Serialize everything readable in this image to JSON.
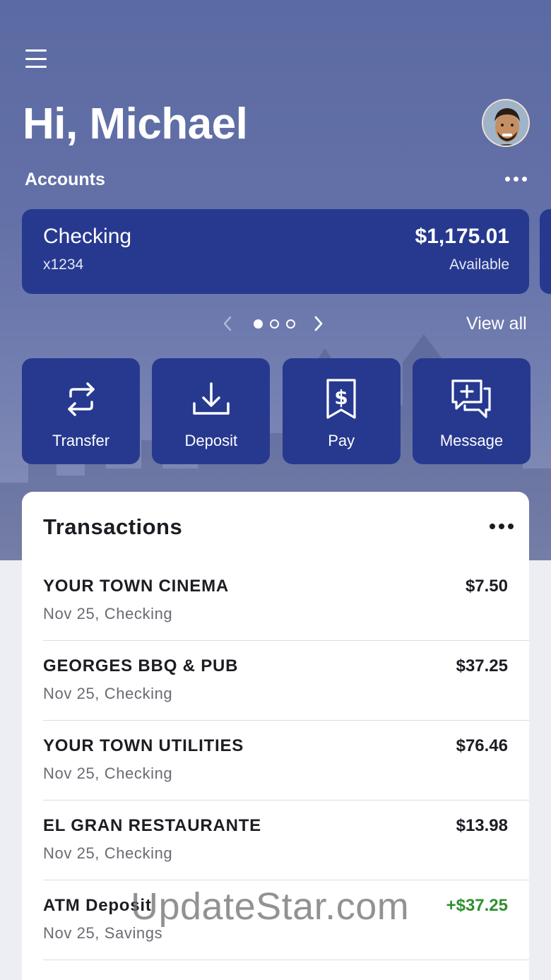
{
  "header": {
    "greeting": "Hi, Michael"
  },
  "accounts": {
    "section_label": "Accounts",
    "cards": [
      {
        "name": "Checking",
        "number": "x1234",
        "balance": "$1,175.01",
        "balance_label": "Available"
      }
    ],
    "pager": {
      "total": 3,
      "active": 1
    },
    "view_all_label": "View all"
  },
  "actions": [
    {
      "label": "Transfer",
      "icon": "transfer-icon"
    },
    {
      "label": "Deposit",
      "icon": "deposit-icon"
    },
    {
      "label": "Pay",
      "icon": "bill-pay-icon"
    },
    {
      "label": "Message",
      "icon": "message-icon"
    }
  ],
  "transactions": {
    "title": "Transactions",
    "items": [
      {
        "name": "YOUR TOWN CINEMA",
        "detail": "Nov 25, Checking",
        "amount": "$7.50",
        "credit": false
      },
      {
        "name": "GEORGES BBQ & PUB",
        "detail": "Nov 25, Checking",
        "amount": "$37.25",
        "credit": false
      },
      {
        "name": "YOUR TOWN UTILITIES",
        "detail": "Nov 25, Checking",
        "amount": "$76.46",
        "credit": false
      },
      {
        "name": "EL GRAN RESTAURANTE",
        "detail": "Nov 25, Checking",
        "amount": "$13.98",
        "credit": false
      },
      {
        "name": "ATM Deposit",
        "detail": "Nov 25, Savings",
        "amount": "+$37.25",
        "credit": true
      }
    ]
  },
  "watermark": "UpdateStar.com",
  "colors": {
    "card_blue": "#27398f",
    "credit_green": "#2f8f2f",
    "hero_bg": "#5c6aa3"
  }
}
